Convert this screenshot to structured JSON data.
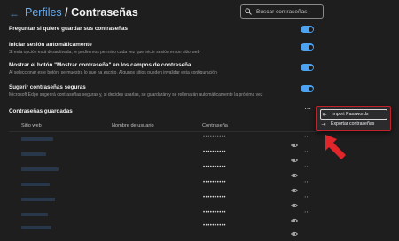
{
  "header": {
    "parent": "Perfiles",
    "separator": " / ",
    "title": "Contraseñas"
  },
  "search": {
    "placeholder": "Buscar contraseñas"
  },
  "settings": [
    {
      "title": "Preguntar si quiere guardar sus contraseñas",
      "description": "",
      "enabled": true
    },
    {
      "title": "Iniciar sesión automáticamente",
      "description": "Si esta opción está desactivada, le pediremos permiso cada vez que inicie sesión en un sitio web",
      "enabled": true
    },
    {
      "title": "Mostrar el botón \"Mostrar contraseña\" en los campos de contraseña",
      "description": "Al seleccionar este botón, se muestra lo que ha escrito. Algunos sitios pueden invalidar esta configuración",
      "enabled": true
    },
    {
      "title": "Sugerir contraseñas seguras",
      "description": "Microsoft Edge sugerirá contraseñas seguras y, si decides usarlas, se guardarán y se rellenarán automáticamente la próxima vez",
      "enabled": true
    }
  ],
  "saved": {
    "title": "Contraseñas guardadas",
    "columns": {
      "site": "Sitio web",
      "user": "Nombre de usuario",
      "password": "Contraseña"
    },
    "password_mask": "••••••••••"
  },
  "menu": {
    "items": [
      {
        "label": "Import Passwords",
        "icon": "import-icon"
      },
      {
        "label": "Exportar contraseñas",
        "icon": "export-icon"
      }
    ]
  },
  "colors": {
    "accent": "#4da3f0",
    "highlight": "#c0242a",
    "background": "#1e1e1f"
  }
}
